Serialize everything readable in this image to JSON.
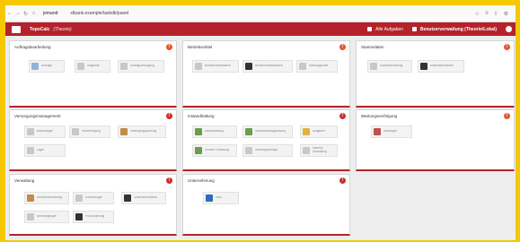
{
  "browser": {
    "nav": [
      "←",
      "→",
      "↻",
      "⌂"
    ],
    "domain": "jemand",
    "path": "xtbank.example/taskdb/panel",
    "right_icons": [
      "star-icon",
      "menu-icon",
      "download-icon",
      "settings-icon"
    ]
  },
  "header": {
    "title": "TopoCalc",
    "user": "(Theorie)",
    "right_links": [
      "Alle Aufgaben",
      "Benutzerverwaltung (Theorie/Lokal)"
    ],
    "brand_color": "#b5222b"
  },
  "panels": {
    "p1": {
      "title": "Auftragsbearbeitung",
      "icon": "!",
      "tiles": [
        "Aufträge",
        "Angebote",
        "Auftragsverfolgung"
      ]
    },
    "p2": {
      "title": "Betriebsmittel",
      "icon": "!",
      "tiles": [
        "Betriebsmittelstamm",
        "Betriebsmittelbestand",
        "Wartungspläne"
      ]
    },
    "p3": {
      "title": "Stammdaten",
      "icon": "!",
      "tiles": [
        "Adressverwaltung",
        "Artikelstammdaten"
      ]
    },
    "p4": {
      "title": "Versorgungsmanagement",
      "icon": "!",
      "tiles": [
        "Bestellungen",
        "Wareneingang",
        "Versorgungsplanung",
        "Lager"
      ]
    },
    "p5": {
      "title": "Instandhaltung",
      "icon": "!",
      "tiles": [
        "Instandhaltung",
        "Instandhaltungsplanung",
        "Aufgaben",
        "Stunden Erfassung",
        "Wartungsaufträge",
        "Material Verwaltung"
      ]
    },
    "p6": {
      "title": "Wartungsverfolgung",
      "icon": "!",
      "tiles": [
        "Wartungen"
      ]
    },
    "p7": {
      "title": "Verwaltung",
      "icon": "!",
      "tiles": [
        "Benutzerverwaltung",
        "Einstellungen",
        "Systeminformation",
        "Berechtigungen",
        "Protokollierung"
      ]
    },
    "p8": {
      "title": "Unternehmung",
      "icon": "!",
      "tiles": [
        "Infos"
      ]
    }
  }
}
